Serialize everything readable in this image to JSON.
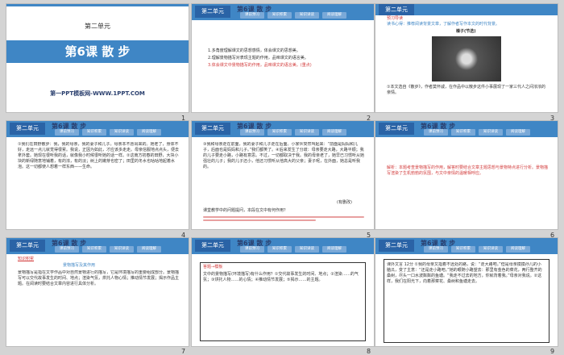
{
  "slides": [
    {
      "num": "1",
      "unit": "第二单元",
      "lesson_title": "第6课  散  步",
      "footer": "第一PPT模板网-WWW.1PPT.COM"
    },
    {
      "num": "2",
      "unit": "第二单元",
      "lesson": "第6课  散  步",
      "nav": [
        "课前预习",
        "知识积累",
        "知识详读",
        "阅读理解"
      ],
      "goals": [
        "1.多角度理解课文的思想感情，体会课文的思想美。",
        "2.理解景物描写对表现主题的作用，品味课文的语言美。",
        "3.体会课文中景物描写的作用，品味课文的语言美。(重点)"
      ]
    },
    {
      "num": "3",
      "unit": "第二单元",
      "tag": "预习导读",
      "caption": "榛子(节选)",
      "intro": "读书心得：推荐阅读背景文章，了解作者写作本文的时代背景。",
      "body": "①本文选自《散步》，作者莫怀戚，在作品中以散步这件小事展现了一家三代人之间浓浓的亲情。"
    },
    {
      "num": "4",
      "unit": "第二单元",
      "lesson": "第6课  散  步",
      "nav": [
        "课前预习",
        "知识积累",
        "知识详读",
        "阅读理解"
      ],
      "text": "①我们在田野散步：我，我的母亲，我的妻子和儿子。母亲本不愿出来的。她老了，身体不好，走远一点儿就觉得很累。我说，正因为如此，才应该多走走。母亲信服地点点头，便去拿外套。她现在很听我的话，就像我小时候很听她的话一样。②这南方初春的田野，大块小块的新绿随意地铺着，有的浓，有的淡；树上的嫩芽也密了；田里的冬水也咕咕地起着水泡。这一切都使人想着一样东西——生命。"
    },
    {
      "num": "5",
      "unit": "第二单元",
      "lesson": "第6课  散  步",
      "nav": [
        "课前预习",
        "知识积累",
        "知识详读",
        "阅读理解"
      ],
      "text": "③我和母亲走在前面，我的妻子和儿子走在后面。小家伙突然叫起来：“前面是妈妈和儿子，后面也是妈妈和儿子。”我们都笑了。④后来发生了分歧：母亲要走大路，大路平顺；我的儿子要走小路，小路有意思。不过，一切都取决于我。我的母亲老了，她早已习惯听从她强壮的儿子；我的儿子还小，他还习惯听从他高大的父亲；妻子呢，在外面，她总是听我的。",
      "q": "课堂教学中的问题提问，本段在文中有何作用？",
      "src": "(有删改)"
    },
    {
      "num": "6",
      "unit": "第二单元",
      "lesson": "第6课  散  步",
      "nav": [
        "课前预习",
        "知识积累",
        "知识详读",
        "阅读理解"
      ],
      "answer": "解析：本题考查景物描写的作用，解答时要结合文章主题思想与景物特点进行分析。景物描写渲染了生机勃勃的氛围，与文中亲情的温暖相呼应。"
    },
    {
      "num": "7",
      "unit": "第二单元",
      "lesson": "第6课  散  步",
      "nav": [
        "课前预习",
        "知识积累",
        "知识详读",
        "阅读理解"
      ],
      "tag": "知识积累",
      "heading": "景物描写及其作用",
      "text": "景物描写是指在文学作品中对自然景物进行的描写，它是环境描写的重要组成部分。景物描写可以交代故事发生的时间、地点；渲染气氛，烘托人物心情；推动情节发展；揭示作品主题。在阅读时要结合文章内容进行具体分析。"
    },
    {
      "num": "8",
      "unit": "第二单元",
      "lesson": "第6课  散  步",
      "nav": [
        "课前预习",
        "知识积累",
        "知识详读",
        "阅读理解"
      ],
      "box_title": "答题→模板",
      "box_text": "文中的景物描写(环境描写)有什么作用？①交代故事发生的时间、地点；②渲染……的气氛；③烘托人物……的心情；④推动情节发展；⑤揭示……的主题。"
    },
    {
      "num": "9",
      "unit": "第二单元",
      "lesson": "第6课  散  步",
      "nav": [
        "课前预习",
        "知识积累",
        "知识详读",
        "阅读理解"
      ],
      "text": "课外文言  12分  ①我的母亲又指着不远处的路，说：“走大路吧。”但是母亲摸摸孙儿的小脑瓜，变了主意：“还是走小路吧。”她的眼随小路望去：那里有金色的菜花，两行整齐的桑树，尽头一口水波粼粼的鱼塘。“我走不过去的地方，你就背着我。”母亲对我说。②这样，我们在阳光下，向着那菜花、桑树和鱼塘走去。"
    }
  ]
}
